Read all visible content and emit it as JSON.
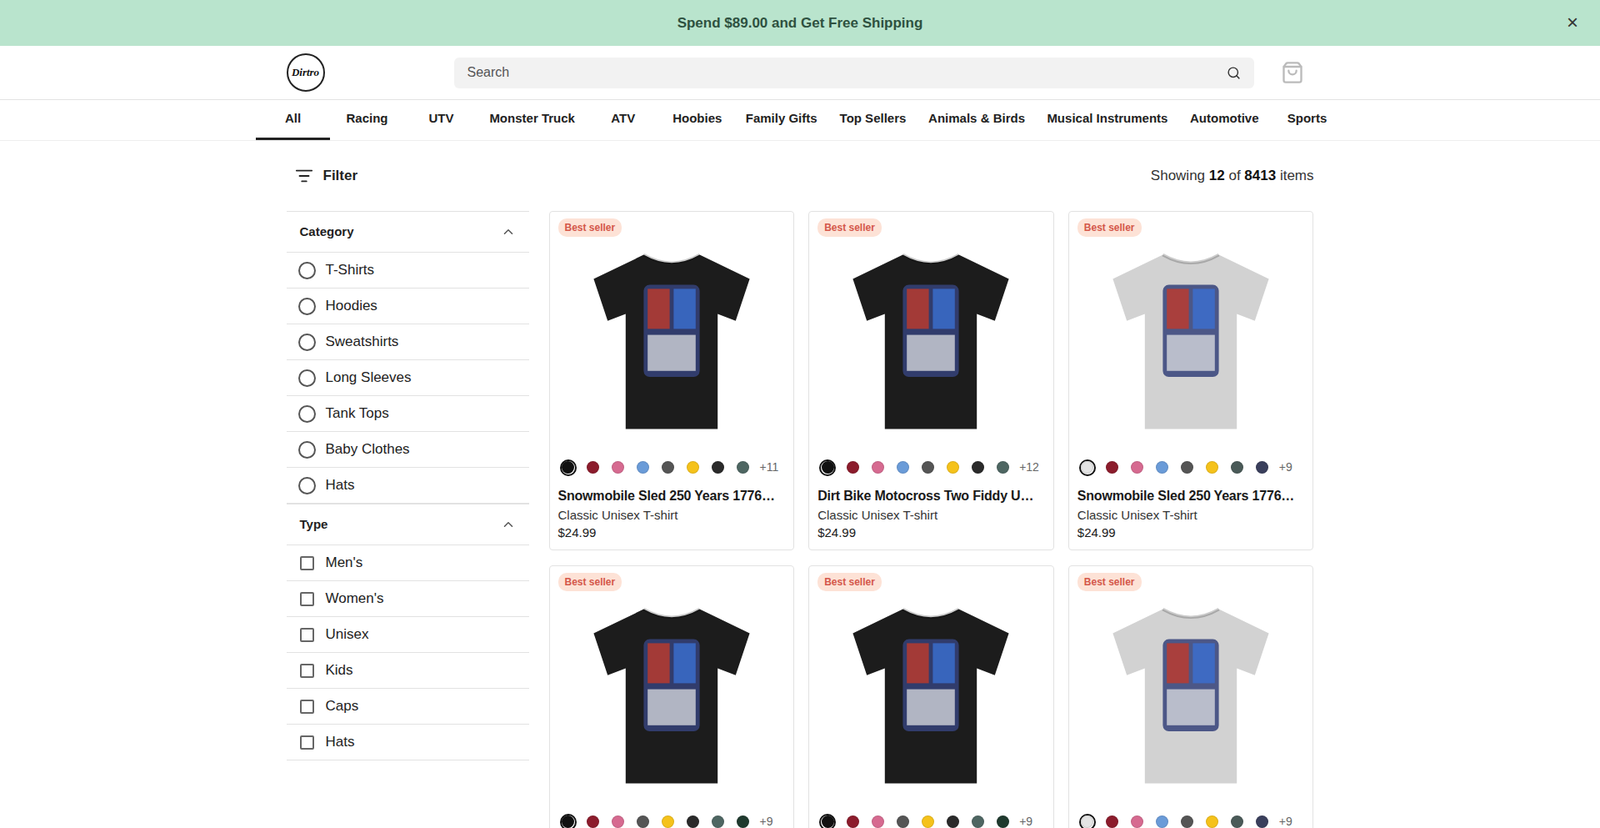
{
  "banner": {
    "text": "Spend $89.00 and Get Free Shipping",
    "close": "×"
  },
  "header": {
    "logo": "Dirtro",
    "search": {
      "placeholder": "Search"
    }
  },
  "nav": [
    {
      "label": "All",
      "selected": true
    },
    {
      "label": "Racing",
      "selected": false
    },
    {
      "label": "UTV",
      "selected": false
    },
    {
      "label": "Monster Truck",
      "selected": false
    },
    {
      "label": "ATV",
      "selected": false
    },
    {
      "label": "Hoobies",
      "selected": false
    },
    {
      "label": "Family Gifts",
      "selected": false
    },
    {
      "label": "Top Sellers",
      "selected": false
    },
    {
      "label": "Animals & Birds",
      "selected": false
    },
    {
      "label": "Musical Instruments",
      "selected": false
    },
    {
      "label": "Automotive",
      "selected": false
    },
    {
      "label": "Sports",
      "selected": false
    }
  ],
  "toolbar": {
    "filter": "Filter",
    "showing": [
      "Showing ",
      "12",
      " of ",
      "8413",
      " items"
    ]
  },
  "filters": [
    {
      "title": "Category",
      "expanded": true,
      "kind": "radio",
      "options": [
        {
          "label": "T-Shirts",
          "selected": false
        },
        {
          "label": "Hoodies",
          "selected": false
        },
        {
          "label": "Sweatshirts",
          "selected": false
        },
        {
          "label": "Long Sleeves",
          "selected": false
        },
        {
          "label": "Tank Tops",
          "selected": false
        },
        {
          "label": "Baby Clothes",
          "selected": false
        },
        {
          "label": "Hats",
          "selected": false
        }
      ]
    },
    {
      "title": "Type",
      "expanded": true,
      "kind": "checkbox",
      "options": [
        {
          "label": "Men's",
          "checked": false
        },
        {
          "label": "Women's",
          "checked": false
        },
        {
          "label": "Unisex",
          "checked": false
        },
        {
          "label": "Kids",
          "checked": false
        },
        {
          "label": "Caps",
          "checked": false
        },
        {
          "label": "Hats",
          "checked": false
        }
      ]
    }
  ],
  "products": [
    {
      "badge": "Best seller",
      "shirt_color": "#1c1c1c",
      "swatches": [
        {
          "color": "#111111",
          "selected": true
        },
        {
          "color": "#8c1c2c",
          "selected": false
        },
        {
          "color": "#d66a90",
          "selected": false
        },
        {
          "color": "#6a9bd8",
          "selected": false
        },
        {
          "color": "#555555",
          "selected": false
        },
        {
          "color": "#f5c21b",
          "selected": false
        },
        {
          "color": "#2a2a2a",
          "selected": false
        },
        {
          "color": "#4e6662",
          "selected": false
        }
      ],
      "more": "+11",
      "title": "Snowmobile Sled 250 Years 1776…",
      "subtitle": "Classic Unisex T-shirt",
      "price": "$24.99"
    },
    {
      "badge": "Best seller",
      "shirt_color": "#1c1c1c",
      "swatches": [
        {
          "color": "#111111",
          "selected": true
        },
        {
          "color": "#8c1c2c",
          "selected": false
        },
        {
          "color": "#d66a90",
          "selected": false
        },
        {
          "color": "#6a9bd8",
          "selected": false
        },
        {
          "color": "#555555",
          "selected": false
        },
        {
          "color": "#f5c21b",
          "selected": false
        },
        {
          "color": "#2a2a2a",
          "selected": false
        },
        {
          "color": "#4e6662",
          "selected": false
        }
      ],
      "more": "+12",
      "title": "Dirt Bike Motocross Two Fiddy U…",
      "subtitle": "Classic Unisex T-shirt",
      "price": "$24.99"
    },
    {
      "badge": "Best seller",
      "shirt_color": "#d2d2d2",
      "swatches": [
        {
          "color": "#e4e4e4",
          "selected": true
        },
        {
          "color": "#8c1c2c",
          "selected": false
        },
        {
          "color": "#d66a90",
          "selected": false
        },
        {
          "color": "#6a9bd8",
          "selected": false
        },
        {
          "color": "#555555",
          "selected": false
        },
        {
          "color": "#f5c21b",
          "selected": false
        },
        {
          "color": "#4a5a58",
          "selected": false
        },
        {
          "color": "#3a3f5c",
          "selected": false
        }
      ],
      "more": "+9",
      "title": "Snowmobile Sled 250 Years 1776…",
      "subtitle": "Classic Unisex T-shirt",
      "price": "$24.99"
    },
    {
      "badge": "Best seller",
      "shirt_color": "#1c1c1c",
      "swatches": [
        {
          "color": "#111111",
          "selected": true
        },
        {
          "color": "#8c1c2c",
          "selected": false
        },
        {
          "color": "#d66a90",
          "selected": false
        },
        {
          "color": "#555555",
          "selected": false
        },
        {
          "color": "#f5c21b",
          "selected": false
        },
        {
          "color": "#2a2a2a",
          "selected": false
        },
        {
          "color": "#4e6662",
          "selected": false
        },
        {
          "color": "#1f3a2e",
          "selected": false
        }
      ],
      "more": "+9"
    },
    {
      "badge": "Best seller",
      "shirt_color": "#1c1c1c",
      "swatches": [
        {
          "color": "#111111",
          "selected": true
        },
        {
          "color": "#8c1c2c",
          "selected": false
        },
        {
          "color": "#d66a90",
          "selected": false
        },
        {
          "color": "#555555",
          "selected": false
        },
        {
          "color": "#f5c21b",
          "selected": false
        },
        {
          "color": "#2a2a2a",
          "selected": false
        },
        {
          "color": "#4e6662",
          "selected": false
        },
        {
          "color": "#1f3a2e",
          "selected": false
        }
      ],
      "more": "+9"
    },
    {
      "badge": "Best seller",
      "shirt_color": "#d2d2d2",
      "swatches": [
        {
          "color": "#e4e4e4",
          "selected": true
        },
        {
          "color": "#8c1c2c",
          "selected": false
        },
        {
          "color": "#d66a90",
          "selected": false
        },
        {
          "color": "#6a9bd8",
          "selected": false
        },
        {
          "color": "#555555",
          "selected": false
        },
        {
          "color": "#f5c21b",
          "selected": false
        },
        {
          "color": "#4a5a58",
          "selected": false
        },
        {
          "color": "#3a3f5c",
          "selected": false
        }
      ],
      "more": "+9"
    }
  ]
}
